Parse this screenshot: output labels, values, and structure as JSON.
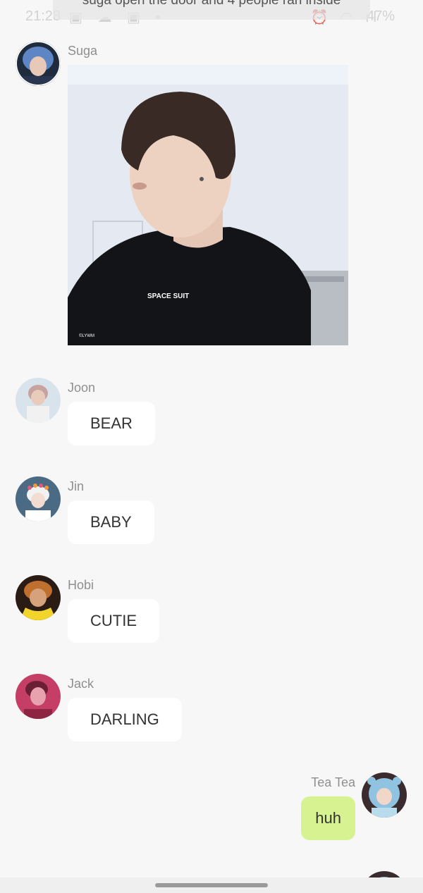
{
  "status_bar": {
    "time": "21:28",
    "battery": "47%"
  },
  "notification": {
    "text": "suga open the door and 4 people ran inside"
  },
  "messages": [
    {
      "sender": "Suga",
      "type": "image",
      "image_caption": "SPACE SUIT",
      "avatar_icon": "avatar-blue-hair"
    },
    {
      "sender": "Joon",
      "type": "text",
      "text": "BEAR",
      "avatar_icon": "avatar-pink-hair"
    },
    {
      "sender": "Jin",
      "type": "text",
      "text": "BABY",
      "avatar_icon": "avatar-flower-crown"
    },
    {
      "sender": "Hobi",
      "type": "text",
      "text": "CUTIE",
      "avatar_icon": "avatar-yellow-shirt"
    },
    {
      "sender": "Jack",
      "type": "text",
      "text": "DARLING",
      "avatar_icon": "avatar-red-tint"
    },
    {
      "sender": "Tea Tea",
      "type": "text",
      "text": "huh",
      "mine": true,
      "avatar_icon": "avatar-bear-hood"
    },
    {
      "sender": "Tea Tea",
      "type": "partial",
      "mine": true
    }
  ],
  "colors": {
    "background": "#f7f7f7",
    "bubble_other": "#ffffff",
    "bubble_mine": "#d7f291",
    "sender_name": "#8f8f8f"
  }
}
